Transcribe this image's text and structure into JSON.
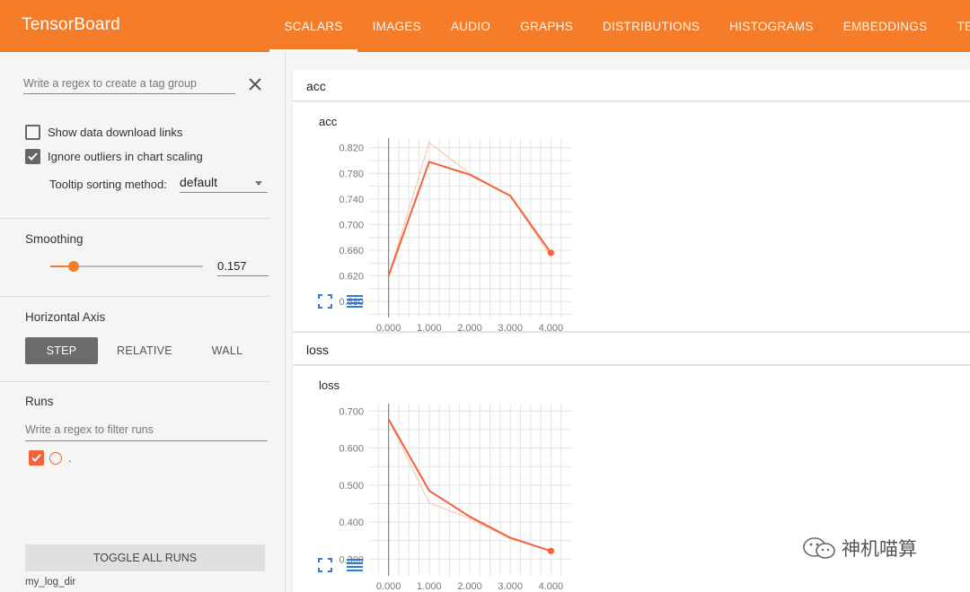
{
  "header": {
    "brand": "TensorBoard",
    "tabs": [
      "SCALARS",
      "IMAGES",
      "AUDIO",
      "GRAPHS",
      "DISTRIBUTIONS",
      "HISTOGRAMS",
      "EMBEDDINGS",
      "TEXT"
    ],
    "active_tab": "SCALARS",
    "accent_color": "#f57c28"
  },
  "sidebar": {
    "tag_regex_placeholder": "Write a regex to create a tag group",
    "show_download_links": {
      "label": "Show data download links",
      "checked": false
    },
    "ignore_outliers": {
      "label": "Ignore outliers in chart scaling",
      "checked": true
    },
    "tooltip_sorting": {
      "label": "Tooltip sorting method:",
      "value": "default"
    },
    "smoothing": {
      "title": "Smoothing",
      "value": "0.157",
      "fraction": 0.157
    },
    "horizontal_axis": {
      "title": "Horizontal Axis",
      "options": [
        "STEP",
        "RELATIVE",
        "WALL"
      ],
      "selected": "STEP"
    },
    "runs": {
      "title": "Runs",
      "filter_placeholder": "Write a regex to filter runs",
      "items": [
        {
          "name": ".",
          "checked": true,
          "color": "#f5623a"
        }
      ],
      "toggle_label": "TOGGLE ALL RUNS",
      "log_dir": "my_log_dir"
    }
  },
  "groups": [
    {
      "name": "acc",
      "card_title": "acc"
    },
    {
      "name": "loss",
      "card_title": "loss"
    }
  ],
  "chart_data": [
    {
      "type": "line",
      "title": "acc",
      "x": [
        0,
        1,
        2,
        3,
        4
      ],
      "x_tick_labels": [
        "0.000",
        "1.000",
        "2.000",
        "3.000",
        "4.000"
      ],
      "xlim": [
        -0.5,
        4.5
      ],
      "ylim": [
        0.555,
        0.835
      ],
      "y_ticks": [
        0.58,
        0.62,
        0.66,
        0.7,
        0.74,
        0.78,
        0.82
      ],
      "y_tick_labels": [
        "0.580",
        "0.620",
        "0.660",
        "0.700",
        "0.740",
        "0.780",
        "0.820"
      ],
      "series": [
        {
          "role": "raw",
          "values": [
            0.62,
            0.828,
            0.78,
            0.745,
            0.65
          ],
          "color": "#f7c9b6"
        },
        {
          "role": "smoothed",
          "values": [
            0.62,
            0.798,
            0.778,
            0.745,
            0.656
          ],
          "color": "#f5623a"
        }
      ],
      "grid": true
    },
    {
      "type": "line",
      "title": "loss",
      "x": [
        0,
        1,
        2,
        3,
        4
      ],
      "x_tick_labels": [
        "0.000",
        "1.000",
        "2.000",
        "3.000",
        "4.000"
      ],
      "xlim": [
        -0.5,
        4.5
      ],
      "ylim": [
        0.255,
        0.72
      ],
      "y_ticks": [
        0.3,
        0.4,
        0.5,
        0.6,
        0.7
      ],
      "y_tick_labels": [
        "0.300",
        "0.400",
        "0.500",
        "0.600",
        "0.700"
      ],
      "series": [
        {
          "role": "raw",
          "values": [
            0.678,
            0.452,
            0.41,
            0.355,
            0.322
          ],
          "color": "#f7c9b6"
        },
        {
          "role": "smoothed",
          "values": [
            0.678,
            0.485,
            0.415,
            0.358,
            0.322
          ],
          "color": "#f5623a"
        }
      ],
      "grid": true
    }
  ],
  "watermark": {
    "text": "神机喵算"
  }
}
